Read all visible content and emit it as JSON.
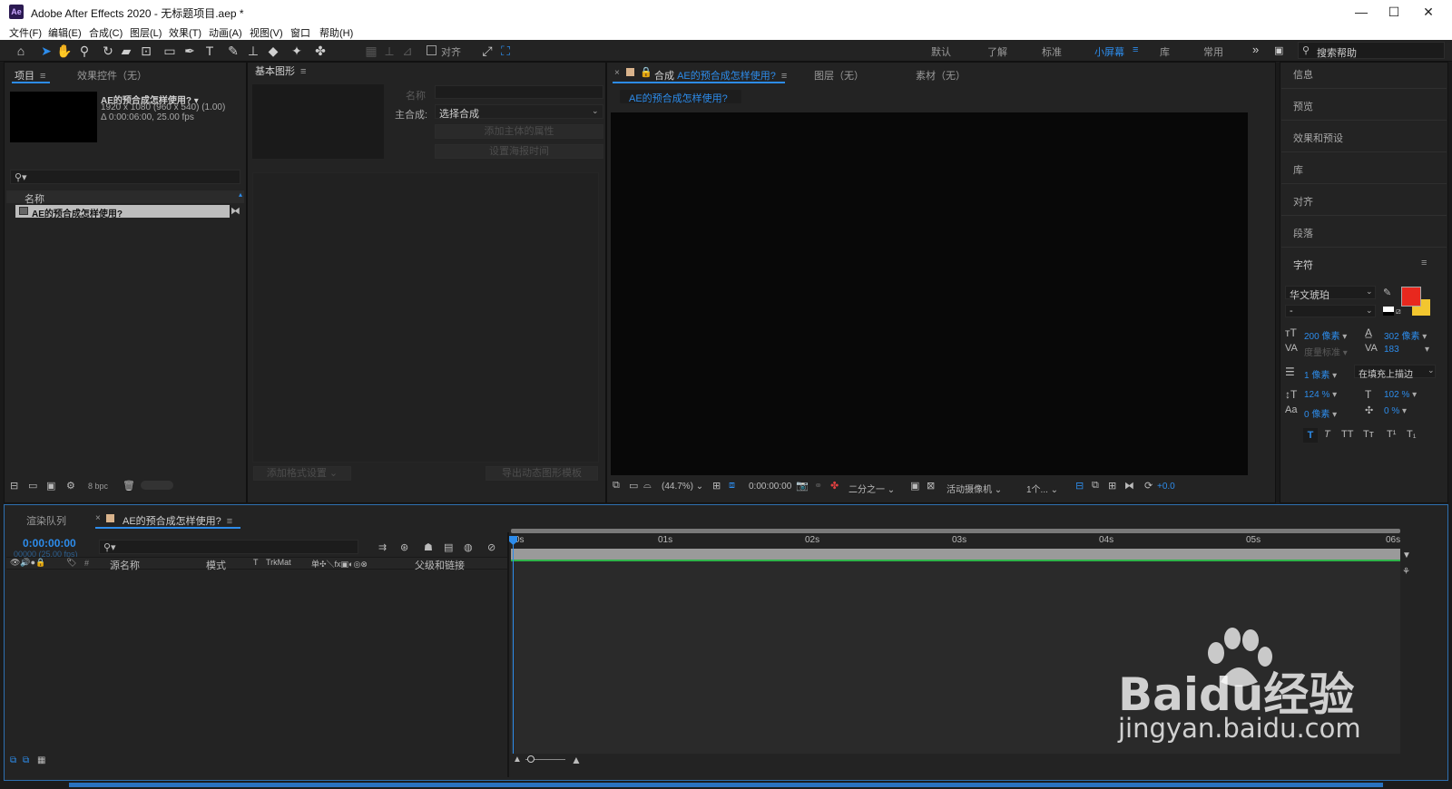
{
  "window": {
    "title": "Adobe After Effects 2020 - 无标题项目.aep *",
    "app_icon": "Ae"
  },
  "menu": [
    "文件(F)",
    "编辑(E)",
    "合成(C)",
    "图层(L)",
    "效果(T)",
    "动画(A)",
    "视图(V)",
    "窗口",
    "帮助(H)"
  ],
  "toolbar": {
    "align_label": "对齐",
    "workspaces": [
      "默认",
      "了解",
      "标准",
      "小屏幕",
      "库",
      "常用"
    ],
    "active_workspace": "小屏幕",
    "search_placeholder": "搜索帮助"
  },
  "project_panel": {
    "tab_project": "项目",
    "tab_effects": "效果控件（无）",
    "comp_name": "AE的预合成怎样使用?",
    "comp_res": "1920 x 1080  (960 x 540) (1.00)",
    "comp_duration": "Δ 0:00:06:00, 25.00 fps",
    "column_name": "名称",
    "items": [
      {
        "name": "AE的预合成怎样使用?"
      }
    ],
    "bpc": "8 bpc"
  },
  "essential_graphics": {
    "title": "基本图形",
    "name_label": "名称",
    "master_label": "主合成:",
    "master_select": "选择合成",
    "add_props_btn": "添加主体的属性",
    "set_poster_btn": "设置海报时间",
    "add_format_btn": "添加格式设置",
    "export_btn": "导出动态图形模板"
  },
  "composition_panel": {
    "tab_comp_prefix": "合成",
    "tab_comp_name": "AE的预合成怎样使用?",
    "tab_layer": "图层（无）",
    "tab_footage": "素材（无）",
    "breadcrumb": "AE的预合成怎样使用?",
    "zoom": "(44.7%)",
    "timecode": "0:00:00:00",
    "resolution": "二分之一",
    "camera": "活动摄像机",
    "views": "1个...",
    "exposure": "+0.0"
  },
  "right_panels": {
    "items": [
      "信息",
      "预览",
      "效果和预设",
      "库",
      "对齐",
      "段落"
    ],
    "character_title": "字符",
    "font": "华文琥珀",
    "font_style": "-",
    "font_size": "200 像素",
    "leading": "302 像素",
    "kerning": "度量标准",
    "tracking": "183",
    "stroke_width": "1 像素",
    "stroke_type": "在填充上描边",
    "vscale": "124 %",
    "hscale": "102 %",
    "baseline": "0 像素",
    "tsume": "0 %",
    "fill_color": "#e8281e",
    "stroke_color": "#f2c62f",
    "style_buttons": [
      "T",
      "T",
      "TT",
      "Tт",
      "T¹",
      "T₁"
    ]
  },
  "timeline": {
    "tab_render": "渲染队列",
    "tab_comp": "AE的预合成怎样使用?",
    "timecode": "0:00:00:00",
    "timecode_sub": "00000 (25.00 fps)",
    "columns": [
      "源名称",
      "模式",
      "T",
      "TrkMat",
      "父级和链接"
    ],
    "ruler": [
      "0s",
      "01s",
      "02s",
      "03s",
      "04s",
      "05s",
      "06s"
    ]
  },
  "watermark": {
    "brand": "Baidu经验",
    "url": "jingyan.baidu.com"
  }
}
